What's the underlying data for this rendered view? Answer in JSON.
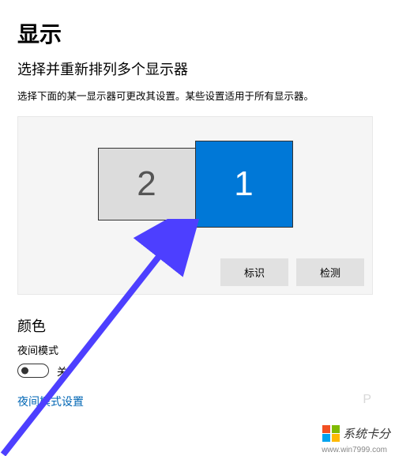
{
  "page": {
    "title": "显示",
    "section_header": "选择并重新排列多个显示器",
    "description": "选择下面的某一显示器可更改其设置。某些设置适用于所有显示器。"
  },
  "displays": {
    "items": [
      {
        "label": "2",
        "selected": false
      },
      {
        "label": "1",
        "selected": true
      }
    ],
    "identify_label": "标识",
    "detect_label": "检测"
  },
  "color": {
    "section_title": "颜色",
    "night_light_label": "夜间模式",
    "toggle_state": "关",
    "night_light_settings_link": "夜间模式设置"
  },
  "watermark": {
    "text": "系统卡分",
    "url": "www.win7999.com",
    "p": "P"
  },
  "colors": {
    "accent": "#0078d7",
    "link": "#0066b4",
    "panel_bg": "#f5f5f5",
    "arrow": "#4d3fff"
  }
}
